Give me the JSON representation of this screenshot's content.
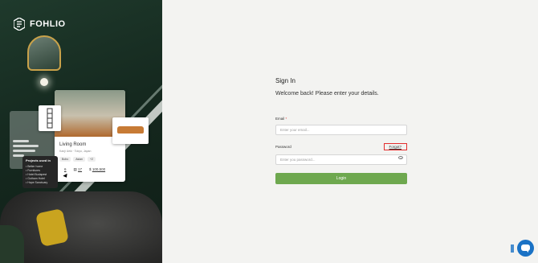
{
  "brand": {
    "name": "FOHLIO"
  },
  "hero": {
    "card": {
      "title": "Living Room",
      "subtitle": "Kanji Ueki  ·  Tokyo, Japan",
      "tags": [
        "Boho",
        "Asian",
        "+2"
      ],
      "stats": {
        "count_a": "6",
        "count_b": "17",
        "price": "100,500"
      }
    },
    "projects": {
      "title": "Projects used in",
      "items": [
        "Better home",
        "Furnitures",
        "Hotel Budapest",
        "Gotham Hotel",
        "Hope Sanctuary"
      ]
    }
  },
  "form": {
    "title": "Sign In",
    "subtitle": "Welcome back! Please enter your details.",
    "email_label": "Email",
    "email_placeholder": "Enter your email...",
    "email_value": "",
    "password_label": "Password",
    "forgot_label": "Forgot?",
    "password_placeholder": "Enter you password...",
    "password_value": "",
    "login_label": "Login",
    "required_mark": "*"
  },
  "colors": {
    "accent": "#6ea84f",
    "highlight": "#e32d2d",
    "chat": "#1a72c5",
    "hero_bg": "#1f3a2c"
  },
  "icons": {
    "logo": "fohlio-logo-icon",
    "password_toggle": "eye-icon",
    "chat": "chat-icon"
  }
}
